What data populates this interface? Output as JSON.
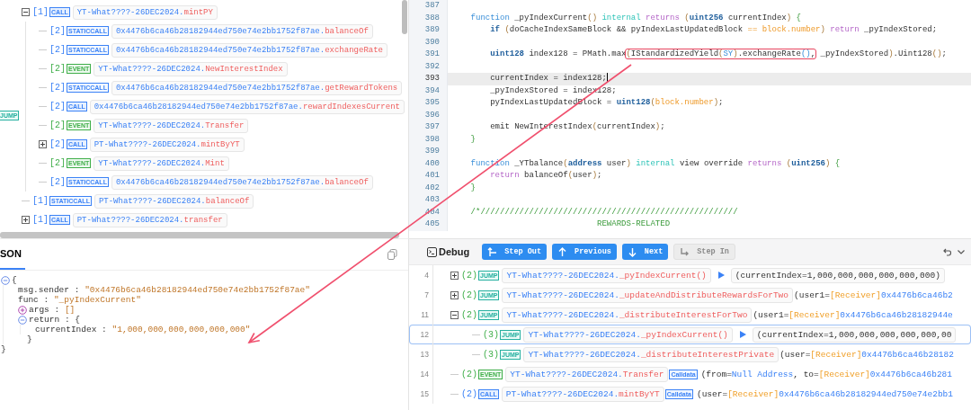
{
  "trace": [
    {
      "expanded": true,
      "depth_label": "[1]",
      "kind": "call",
      "tag": "CALL",
      "contract": "YT-What????-26DEC2024.",
      "method": "mintPY",
      "children": [
        {
          "depth_label": "[2]",
          "kind": "staticcall",
          "tag": "STATICCALL",
          "contract": "0x4476b6ca46b28182944ed750e74e2bb1752f87ae.",
          "method": "balanceOf"
        },
        {
          "depth_label": "[2]",
          "kind": "staticcall",
          "tag": "STATICCALL",
          "contract": "0x4476b6ca46b28182944ed750e74e2bb1752f87ae.",
          "method": "exchangeRate"
        },
        {
          "depth_label": "[2]",
          "kind": "event",
          "tag": "EVENT",
          "contract": "YT-What????-26DEC2024.",
          "method": "NewInterestIndex"
        },
        {
          "depth_label": "[2]",
          "kind": "staticcall",
          "tag": "STATICCALL",
          "contract": "0x4476b6ca46b28182944ed750e74e2bb1752f87ae.",
          "method": "getRewardTokens"
        },
        {
          "depth_label": "[2]",
          "kind": "call",
          "tag": "CALL",
          "contract": "0x4476b6ca46b28182944ed750e74e2bb1752f87ae.",
          "method": "rewardIndexesCurrent",
          "side_tag": "JUMP"
        },
        {
          "depth_label": "[2]",
          "kind": "event",
          "tag": "EVENT",
          "contract": "YT-What????-26DEC2024.",
          "method": "Transfer"
        },
        {
          "expanded": false,
          "depth_label": "[2]",
          "kind": "call",
          "tag": "CALL",
          "contract": "PT-What????-26DEC2024.",
          "method": "mintByYT"
        },
        {
          "depth_label": "[2]",
          "kind": "event",
          "tag": "EVENT",
          "contract": "YT-What????-26DEC2024.",
          "method": "Mint"
        },
        {
          "depth_label": "[2]",
          "kind": "staticcall",
          "tag": "STATICCALL",
          "contract": "0x4476b6ca46b28182944ed750e74e2bb1752f87ae.",
          "method": "balanceOf"
        }
      ]
    },
    {
      "depth_label": "[1]",
      "kind": "staticcall",
      "tag": "STATICCALL",
      "contract": "PT-What????-26DEC2024.",
      "method": "balanceOf"
    },
    {
      "expanded": false,
      "depth_label": "[1]",
      "kind": "call",
      "tag": "CALL",
      "contract": "PT-What????-26DEC2024.",
      "method": "transfer"
    }
  ],
  "json_panel": {
    "tab": {
      "label": "SON",
      "selected": true
    },
    "separator": ":",
    "root": {
      "expanded": true,
      "open": "{",
      "close": "}",
      "entries": [
        {
          "key": "msg.sender",
          "value": "\"0x4476b6ca46b28182944ed750e74e2bb1752f87ae\""
        },
        {
          "key": "func",
          "value": "\"_pyIndexCurrent\""
        },
        {
          "key": "args",
          "value": "[]",
          "expanded": false
        },
        {
          "key": "return",
          "value": "{",
          "expanded": true,
          "close": "}",
          "entries": [
            {
              "key": "currentIndex",
              "value": "\"1,000,000,000,000,000,000\""
            }
          ]
        }
      ]
    }
  },
  "code": [
    {
      "num": "387",
      "current": false
    },
    {
      "num": "388",
      "current": false,
      "tokens": [
        {
          "text": "    function",
          "kind": "kw"
        },
        {
          "text": " _pyIndexCurrent"
        },
        {
          "text": "()",
          "kind": "punc"
        },
        {
          "text": " internal",
          "kind": "mod"
        },
        {
          "text": " returns",
          "kind": "ret"
        },
        {
          "text": " (",
          "kind": "punc"
        },
        {
          "text": "uint256",
          "kind": "type"
        },
        {
          "text": " currentIndex"
        },
        {
          "text": ")",
          "kind": "punc"
        },
        {
          "text": " {",
          "kind": "brace"
        }
      ]
    },
    {
      "num": "389",
      "current": false,
      "tokens": [
        {
          "text": "        if",
          "kind": "type"
        },
        {
          "text": " (",
          "kind": "punc"
        },
        {
          "text": "doCacheIndexSameBlock && pyIndexLastUpdatedBlock"
        },
        {
          "text": " ==",
          "kind": "num"
        },
        {
          "text": " block.number",
          "kind": "num"
        },
        {
          "text": ")",
          "kind": "punc"
        },
        {
          "text": " return",
          "kind": "ret"
        },
        {
          "text": " _pyIndexStored;"
        }
      ]
    },
    {
      "num": "390",
      "current": false
    },
    {
      "num": "391",
      "current": false,
      "tokens": [
        {
          "text": "        uint128",
          "kind": "type"
        },
        {
          "text": " index128 = PMath.max"
        },
        {
          "children": [
            {
              "text": "(",
              "kind": "punc"
            },
            {
              "text": "IStandardizedYield"
            },
            {
              "text": "(",
              "kind": "punc"
            },
            {
              "text": "SY",
              "kind": "kw"
            },
            {
              "text": ")",
              "kind": "punc"
            },
            {
              "text": ".exchangeRate"
            },
            {
              "text": "()",
              "kind": "kw"
            },
            {
              "text": ","
            }
          ]
        },
        {
          "text": " _pyIndexStored"
        },
        {
          "text": ")",
          "kind": "punc"
        },
        {
          "text": ".Uint128"
        },
        {
          "text": "()",
          "kind": "punc"
        },
        {
          "text": ";"
        }
      ]
    },
    {
      "num": "392",
      "current": false
    },
    {
      "num": "393",
      "current": true,
      "tokens": [
        {
          "text": "        currentIndex = index128;"
        }
      ]
    },
    {
      "num": "394",
      "current": false,
      "tokens": [
        {
          "text": "        _pyIndexStored = index128;"
        }
      ]
    },
    {
      "num": "395",
      "current": false,
      "tokens": [
        {
          "text": "        pyIndexLastUpdatedBlock ="
        },
        {
          "text": " uint128",
          "kind": "type"
        },
        {
          "text": "(",
          "kind": "punc"
        },
        {
          "text": "block.number",
          "kind": "num"
        },
        {
          "text": ")",
          "kind": "punc"
        },
        {
          "text": ";"
        }
      ]
    },
    {
      "num": "396",
      "current": false
    },
    {
      "num": "397",
      "current": false,
      "tokens": [
        {
          "text": "        emit NewInterestIndex"
        },
        {
          "text": "(",
          "kind": "punc"
        },
        {
          "text": "currentIndex"
        },
        {
          "text": ")",
          "kind": "punc"
        },
        {
          "text": ";"
        }
      ]
    },
    {
      "num": "398",
      "current": false,
      "tokens": [
        {
          "text": "    }",
          "kind": "brace"
        }
      ]
    },
    {
      "num": "399",
      "current": false
    },
    {
      "num": "400",
      "current": false,
      "tokens": [
        {
          "text": "    function",
          "kind": "kw"
        },
        {
          "text": " _YTbalance"
        },
        {
          "text": "(",
          "kind": "punc"
        },
        {
          "text": "address",
          "kind": "type"
        },
        {
          "text": " user"
        },
        {
          "text": ")",
          "kind": "punc"
        },
        {
          "text": " internal",
          "kind": "mod"
        },
        {
          "text": " view override"
        },
        {
          "text": " returns",
          "kind": "ret"
        },
        {
          "text": " (",
          "kind": "punc"
        },
        {
          "text": "uint256",
          "kind": "type"
        },
        {
          "text": ")",
          "kind": "punc"
        },
        {
          "text": " {",
          "kind": "brace"
        }
      ]
    },
    {
      "num": "401",
      "current": false,
      "tokens": [
        {
          "text": "        return",
          "kind": "ret"
        },
        {
          "text": " balanceOf"
        },
        {
          "text": "(",
          "kind": "punc"
        },
        {
          "text": "user"
        },
        {
          "text": ")",
          "kind": "punc"
        },
        {
          "text": ";"
        }
      ]
    },
    {
      "num": "402",
      "current": false,
      "tokens": [
        {
          "text": "    }",
          "kind": "brace"
        }
      ]
    },
    {
      "num": "403",
      "current": false
    },
    {
      "num": "404",
      "current": false,
      "tokens": [
        {
          "text": "    /*/////////////////////////////////////////////////////",
          "kind": "comment"
        }
      ]
    },
    {
      "num": "405",
      "current": false,
      "tokens": [
        {
          "text": "                              REWARDS-RELATED",
          "kind": "comment"
        }
      ]
    }
  ],
  "debug": {
    "title": "Debug",
    "buttons": [
      {
        "label": "Step Out",
        "disabled": false
      },
      {
        "label": "Previous",
        "disabled": false
      },
      {
        "label": "Next",
        "disabled": false
      },
      {
        "label": "Step In",
        "disabled": true
      }
    ],
    "rows": [
      {
        "line": "4",
        "expanded": false,
        "depth": "(2)",
        "kind": "jump",
        "tag": "JUMP",
        "contract": "YT-What????-26DEC2024.",
        "method": "_pyIndexCurrent()",
        "result": "(currentIndex=1,000,000,000,000,000,000)",
        "selected": false
      },
      {
        "line": "7",
        "expanded": false,
        "depth": "(2)",
        "kind": "jump",
        "tag": "JUMP",
        "contract": "YT-What????-26DEC2024.",
        "method": "_updateAndDistributeRewardsForTwo",
        "args": [
          {
            "text": "(user1=",
            "kind": "plain"
          },
          {
            "text": "[Receiver]",
            "kind": "label"
          },
          {
            "text": "0x4476b6ca46b2",
            "kind": "address"
          }
        ],
        "selected": false
      },
      {
        "line": "11",
        "expanded": true,
        "depth": "(2)",
        "kind": "jump",
        "tag": "JUMP",
        "contract": "YT-What????-26DEC2024.",
        "method": "_distributeInterestForTwo",
        "args": [
          {
            "text": "(user1=",
            "kind": "plain"
          },
          {
            "text": "[Receiver]",
            "kind": "label"
          },
          {
            "text": "0x4476b6ca46b28182944e",
            "kind": "address"
          }
        ],
        "selected": false,
        "children": [
          {
            "line": "12",
            "depth": "(3)",
            "kind": "jump",
            "tag": "JUMP",
            "contract": "YT-What????-26DEC2024.",
            "method": "_pyIndexCurrent()",
            "result": "(currentIndex=1,000,000,000,000,000,00",
            "selected": true
          },
          {
            "line": "13",
            "depth": "(3)",
            "kind": "jump",
            "tag": "JUMP",
            "contract": "YT-What????-26DEC2024.",
            "method": "_distributeInterestPrivate",
            "args": [
              {
                "text": "(user=",
                "kind": "plain"
              },
              {
                "text": "[Receiver]",
                "kind": "label"
              },
              {
                "text": "0x4476b6ca46b28182",
                "kind": "address"
              }
            ],
            "selected": false
          }
        ]
      },
      {
        "line": "14",
        "depth": "(2)",
        "kind": "event",
        "tag": "EVENT",
        "contract": "YT-What????-26DEC2024.",
        "method": "Transfer",
        "calldata": "Calldata",
        "args": [
          {
            "text": "(from=",
            "kind": "plain"
          },
          {
            "text": "Null Address",
            "kind": "address"
          },
          {
            "text": ", to=",
            "kind": "plain"
          },
          {
            "text": "[Receiver]",
            "kind": "label"
          },
          {
            "text": "0x4476b6ca46b281",
            "kind": "address"
          }
        ],
        "selected": false
      },
      {
        "line": "15",
        "depth": "(2)",
        "kind": "call",
        "tag": "CALL",
        "contract": "PT-What????-26DEC2024.",
        "method": "mintByYT",
        "calldata": "Calldata",
        "args": [
          {
            "text": "(user=",
            "kind": "plain"
          },
          {
            "text": "[Receiver]",
            "kind": "label"
          },
          {
            "text": "0x4476b6ca46b28182944ed750e74e2bb1",
            "kind": "address"
          }
        ],
        "selected": false
      }
    ]
  }
}
